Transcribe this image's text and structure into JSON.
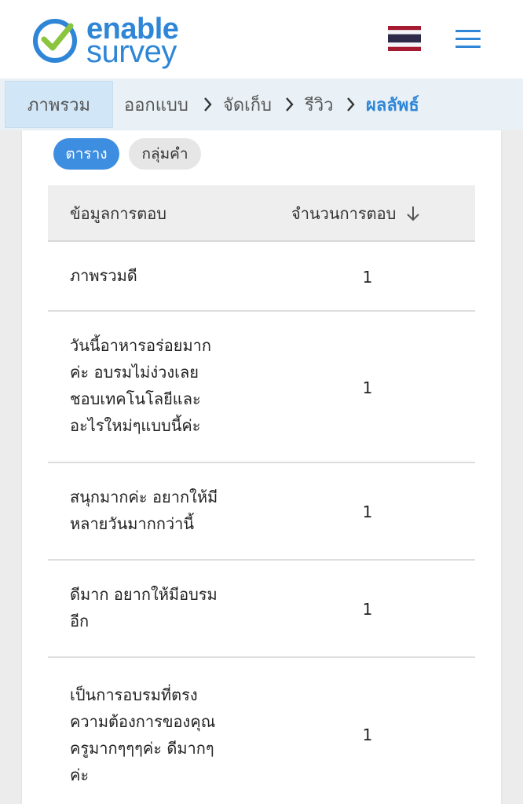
{
  "header": {
    "logo_top": "enable",
    "logo_bottom": "survey",
    "flag": "thailand-flag",
    "menu_icon": "hamburger-menu-icon"
  },
  "breadcrumb": {
    "items": [
      {
        "label": "ภาพรวม"
      },
      {
        "label": "ออกแบบ"
      },
      {
        "label": "จัดเก็บ"
      },
      {
        "label": "รีวิว"
      },
      {
        "label": "ผลลัพธ์"
      }
    ],
    "separator": "chevron-right-icon"
  },
  "view_toggle": {
    "table_label": "ตาราง",
    "wordcloud_label": "กลุ่มคำ"
  },
  "table": {
    "columns": [
      "ข้อมูลการตอบ",
      "จำนวนการตอบ"
    ],
    "sort_icon": "arrow-down-icon",
    "rows": [
      {
        "lines": [
          "ภาพรวมดี"
        ],
        "count": "1"
      },
      {
        "lines": [
          "วันนี้อาหารอร่อยมาก",
          "ค่ะ อบรมไม่ง่วงเลย",
          "ชอบเทคโนโลยีและ",
          "อะไรใหม่ๆแบบนี้ค่ะ"
        ],
        "count": "1"
      },
      {
        "lines": [
          "สนุกมากค่ะ อยากให้มี",
          "หลายวันมากกว่านี้"
        ],
        "count": "1"
      },
      {
        "lines": [
          "ดีมาก อยากให้มีอบรม",
          "อีก"
        ],
        "count": "1"
      },
      {
        "lines": [
          "เป็นการอบรมที่ตรง",
          "ความต้องการของคุณ",
          "ครูมากๆๆๆค่ะ ดีมากๆ",
          "ค่ะ"
        ],
        "count": "1"
      }
    ]
  },
  "colors": {
    "brand_blue": "#2f86d6",
    "breadcrumb_bg": "#e9f1f6",
    "active_pill": "#3d8ee0"
  }
}
